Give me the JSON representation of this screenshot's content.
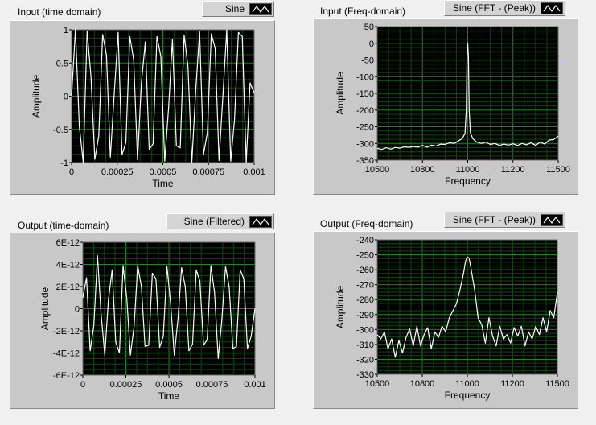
{
  "graphs": [
    {
      "id": "input-time",
      "title": "Input (time domain)",
      "legend": "Sine",
      "chart_data": {
        "type": "line",
        "xlabel": "Time",
        "ylabel": "Amplitude",
        "xlim": [
          0,
          0.001
        ],
        "ylim": [
          -1,
          1
        ],
        "xticks": [
          "0",
          "0.00025",
          "0.0005",
          "0.00075",
          "0.001"
        ],
        "yticks": [
          "1",
          "0.5",
          "0",
          "-0.5",
          "-1"
        ],
        "series": [
          {
            "x": [
              0,
              2.13e-05,
              4.25e-05,
              6.38e-05,
              8.5e-05,
              0.0001063,
              0.0001275,
              0.0001488,
              0.00017,
              0.0001913,
              0.0002125,
              0.0002338,
              0.000255,
              0.0002763,
              0.0002975,
              0.0003188,
              0.00034,
              0.0003613,
              0.0003825,
              0.0004038,
              0.000425,
              0.0004463,
              0.0004675,
              0.0004888,
              0.00051,
              0.0005313,
              0.0005525,
              0.0005738,
              0.000595,
              0.0006163,
              0.0006375,
              0.0006588,
              0.00068,
              0.0007013,
              0.0007225,
              0.0007438,
              0.000765,
              0.0007863,
              0.0008075,
              0.0008288,
              0.00085,
              0.0008713,
              0.0008925,
              0.0009138,
              0.000935,
              0.0009563,
              0.0009775,
              0.001
            ],
            "y": [
              0,
              1,
              -0.45,
              -1,
              0.98,
              0.3,
              -0.95,
              -0.6,
              0.93,
              0.62,
              -0.92,
              0.05,
              0.96,
              -0.88,
              -0.7,
              0.9,
              0.55,
              -0.96,
              0.2,
              0.82,
              -0.8,
              -0.72,
              0.9,
              0.6,
              -0.98,
              -0.18,
              0.86,
              -0.75,
              -0.78,
              0.92,
              0.45,
              -1,
              0.1,
              0.97,
              -0.88,
              -0.55,
              0.94,
              0.72,
              -0.97,
              0.0,
              1,
              -0.98,
              -0.35,
              0.96,
              0.9,
              -1,
              0.2,
              0.05
            ]
          }
        ]
      }
    },
    {
      "id": "input-freq",
      "title": "Input (Freq-domain)",
      "legend": "Sine (FFT - (Peak))",
      "chart_data": {
        "type": "line",
        "xlabel": "Frequency",
        "ylabel": "Amplitude",
        "xlim": [
          10500,
          11500
        ],
        "ylim": [
          -350,
          50
        ],
        "xticks": [
          "10500",
          "10800",
          "11000",
          "11200",
          "11500"
        ],
        "yticks": [
          "50",
          "0",
          "-50",
          "-100",
          "-150",
          "-200",
          "-250",
          "-300",
          "-350"
        ],
        "series": [
          {
            "x": [
              10500,
              10525,
              10550,
              10575,
              10600,
              10625,
              10650,
              10675,
              10700,
              10725,
              10750,
              10775,
              10800,
              10825,
              10850,
              10875,
              10900,
              10925,
              10950,
              10970,
              10985,
              10992,
              10996,
              11000,
              11004,
              11008,
              11015,
              11030,
              11050,
              11075,
              11100,
              11125,
              11150,
              11175,
              11200,
              11225,
              11250,
              11275,
              11300,
              11325,
              11350,
              11375,
              11400,
              11425,
              11450,
              11475,
              11500
            ],
            "y": [
              -315,
              -318,
              -313,
              -317,
              -312,
              -314,
              -310,
              -312,
              -309,
              -311,
              -306,
              -311,
              -305,
              -308,
              -302,
              -303,
              -298,
              -300,
              -292,
              -285,
              -270,
              -200,
              -40,
              -2,
              -40,
              -200,
              -270,
              -287,
              -296,
              -300,
              -296,
              -303,
              -300,
              -306,
              -302,
              -305,
              -301,
              -306,
              -300,
              -304,
              -298,
              -306,
              -296,
              -302,
              -290,
              -288,
              -278
            ]
          }
        ]
      }
    },
    {
      "id": "output-time",
      "title": "Output (time-domain)",
      "legend": "Sine (Filtered)",
      "chart_data": {
        "type": "line",
        "xlabel": "Time",
        "ylabel": "Amplitude",
        "xlim": [
          0,
          0.001
        ],
        "ylim": [
          -6e-12,
          6e-12
        ],
        "xticks": [
          "0",
          "0.00025",
          "0.0005",
          "0.00075",
          "0.001"
        ],
        "yticks": [
          "6E-12",
          "4E-12",
          "2E-12",
          "0",
          "-2E-12",
          "-4E-12",
          "-6E-12"
        ],
        "series": [
          {
            "x": [
              0,
              2.13e-05,
              4.25e-05,
              6.38e-05,
              8.5e-05,
              0.0001063,
              0.0001275,
              0.0001488,
              0.00017,
              0.0001913,
              0.0002125,
              0.0002338,
              0.000255,
              0.0002763,
              0.0002975,
              0.0003188,
              0.00034,
              0.0003613,
              0.0003825,
              0.0004038,
              0.000425,
              0.0004463,
              0.0004675,
              0.0004888,
              0.00051,
              0.0005313,
              0.0005525,
              0.0005738,
              0.000595,
              0.0006163,
              0.0006375,
              0.0006588,
              0.00068,
              0.0007013,
              0.0007225,
              0.0007438,
              0.000765,
              0.0007863,
              0.0008075,
              0.0008288,
              0.00085,
              0.0008713,
              0.0008925,
              0.0009138,
              0.000935,
              0.0009563,
              0.0009775,
              0.001
            ],
            "y": [
              1e-12,
              2.8e-12,
              -3.8e-12,
              -1.5e-12,
              4.8e-12,
              -5e-13,
              -4.2e-12,
              8e-13,
              3.5e-12,
              -3e-12,
              -4e-12,
              3.9e-12,
              1e-12,
              -4.2e-12,
              -1.6e-12,
              3.9e-12,
              2e-12,
              -3.4e-12,
              -3.3e-12,
              3.2e-12,
              2.7e-12,
              -3.5e-12,
              -2.5e-12,
              3.8e-12,
              5e-13,
              -4.2e-12,
              -1e-12,
              3.7e-12,
              2e-12,
              -3.8e-12,
              -3.2e-12,
              3.5e-12,
              2.5e-12,
              -3.3e-12,
              -2.8e-12,
              3.9e-12,
              1.5e-12,
              -4.5e-12,
              -1e-12,
              3.8e-12,
              2e-12,
              -3.6e-12,
              -3.4e-12,
              3.5e-12,
              2.7e-12,
              -3.6e-12,
              -2.5e-12,
              0
            ]
          }
        ]
      }
    },
    {
      "id": "output-freq",
      "title": "Output (Freq-domain)",
      "legend": "Sine (FFT - (Peak))",
      "chart_data": {
        "type": "line",
        "xlabel": "Frequency",
        "ylabel": "Amplitude",
        "xlim": [
          10500,
          11500
        ],
        "ylim": [
          -330,
          -235
        ],
        "xticks": [
          "10500",
          "10800",
          "11000",
          "11200",
          "11500"
        ],
        "yticks": [
          "-240",
          "-250",
          "-260",
          "-270",
          "-280",
          "-290",
          "-300",
          "-310",
          "-320",
          "-330"
        ],
        "series": [
          {
            "x": [
              10500,
              10520,
              10540,
              10560,
              10580,
              10600,
              10620,
              10640,
              10660,
              10680,
              10700,
              10720,
              10740,
              10760,
              10780,
              10800,
              10820,
              10840,
              10860,
              10880,
              10900,
              10920,
              10940,
              10960,
              10980,
              10990,
              11000,
              11010,
              11020,
              11040,
              11060,
              11080,
              11100,
              11120,
              11140,
              11160,
              11180,
              11200,
              11220,
              11240,
              11260,
              11280,
              11300,
              11320,
              11340,
              11360,
              11380,
              11400,
              11420,
              11440,
              11460,
              11480,
              11500
            ],
            "y": [
              -302,
              -305,
              -300,
              -312,
              -305,
              -318,
              -306,
              -315,
              -304,
              -298,
              -310,
              -296,
              -310,
              -302,
              -297,
              -312,
              -300,
              -304,
              -296,
              -300,
              -290,
              -285,
              -280,
              -270,
              -258,
              -250,
              -247,
              -248,
              -255,
              -270,
              -290,
              -295,
              -308,
              -290,
              -303,
              -310,
              -296,
              -305,
              -302,
              -308,
              -297,
              -303,
              -296,
              -310,
              -300,
              -305,
              -296,
              -302,
              -290,
              -300,
              -285,
              -290,
              -272
            ]
          }
        ]
      }
    }
  ]
}
